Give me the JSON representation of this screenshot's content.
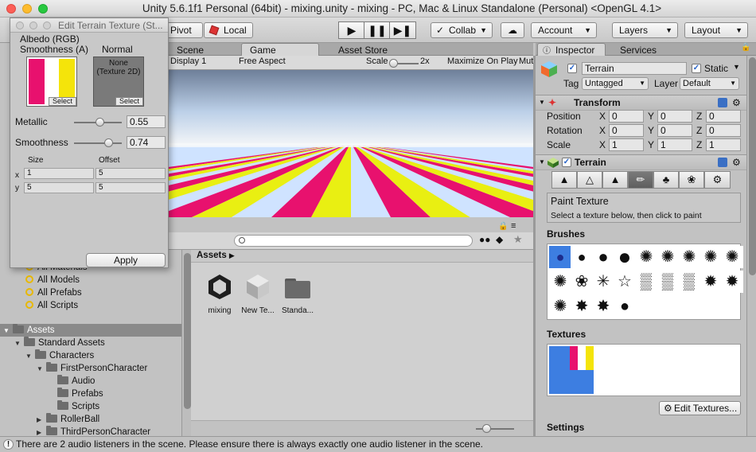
{
  "window": {
    "title": "Unity 5.6.1f1 Personal (64bit) - mixing.unity - mixing - PC, Mac & Linux Standalone (Personal) <OpenGL 4.1>"
  },
  "toolbar": {
    "pivot": "Pivot",
    "local": "Local",
    "collab": "Collab",
    "account": "Account",
    "layers": "Layers",
    "layout": "Layout"
  },
  "tabs": {
    "scene": "Scene",
    "game": "Game",
    "asset_store": "Asset Store",
    "inspector": "Inspector",
    "services": "Services"
  },
  "game": {
    "display": "Display 1",
    "aspect": "Free Aspect",
    "scale_label": "Scale",
    "scale_value": "2x",
    "maximize": "Maximize On Play",
    "mute": "Mut",
    "stripe_colors": [
      "#e8116e",
      "#e9ef12",
      "#cfe3ff"
    ]
  },
  "popup": {
    "title": "Edit Terrain Texture (St...",
    "albedo_label": "Albedo (RGB)",
    "smoothness_label": "Smoothness (A)",
    "normal_label": "Normal",
    "normal_value": "None",
    "normal_type": "(Texture 2D)",
    "select": "Select",
    "metallic_label": "Metallic",
    "metallic_value": "0.55",
    "metallic_frac": 0.55,
    "smooth_label": "Smoothness",
    "smooth_value": "0.74",
    "smooth_frac": 0.74,
    "size_label": "Size",
    "offset_label": "Offset",
    "x_label": "x",
    "y_label": "y",
    "size_x": "1",
    "offset_x": "5",
    "size_y": "5",
    "offset_y": "5",
    "apply": "Apply"
  },
  "project": {
    "search_items": [
      "All Materials",
      "All Models",
      "All Prefabs",
      "All Scripts"
    ],
    "root": "Assets",
    "tree": [
      {
        "label": "Standard Assets",
        "open": true
      },
      {
        "label": "Characters",
        "open": true
      },
      {
        "label": "FirstPersonCharacter",
        "open": true
      },
      {
        "label": "Audio"
      },
      {
        "label": "Prefabs"
      },
      {
        "label": "Scripts"
      },
      {
        "label": "RollerBall",
        "open": false
      },
      {
        "label": "ThirdPersonCharacter",
        "open": false
      }
    ],
    "breadcrumb": "Assets",
    "assets": [
      {
        "label": "mixing",
        "icon": "unity-scene-icon"
      },
      {
        "label": "New Te...",
        "icon": "terrain-data-icon"
      },
      {
        "label": "Standa...",
        "icon": "folder-icon"
      }
    ]
  },
  "inspector": {
    "object_name": "Terrain",
    "static": "Static",
    "tag_label": "Tag",
    "tag_value": "Untagged",
    "layer_label": "Layer",
    "layer_value": "Default",
    "transform": "Transform",
    "position": "Position",
    "rotation": "Rotation",
    "scale": "Scale",
    "x": "X",
    "y": "Y",
    "z": "Z",
    "pos": [
      "0",
      "0",
      "0"
    ],
    "rot": [
      "0",
      "0",
      "0"
    ],
    "scl": [
      "1",
      "1",
      "1"
    ],
    "terrain": "Terrain",
    "paint_title": "Paint Texture",
    "paint_desc": "Select a texture below, then click to paint",
    "brushes": "Brushes",
    "textures": "Textures",
    "edit_textures": "Edit Textures...",
    "settings": "Settings"
  },
  "status": {
    "message": "There are 2 audio listeners in the scene. Please ensure there is always exactly one audio listener in the scene."
  }
}
